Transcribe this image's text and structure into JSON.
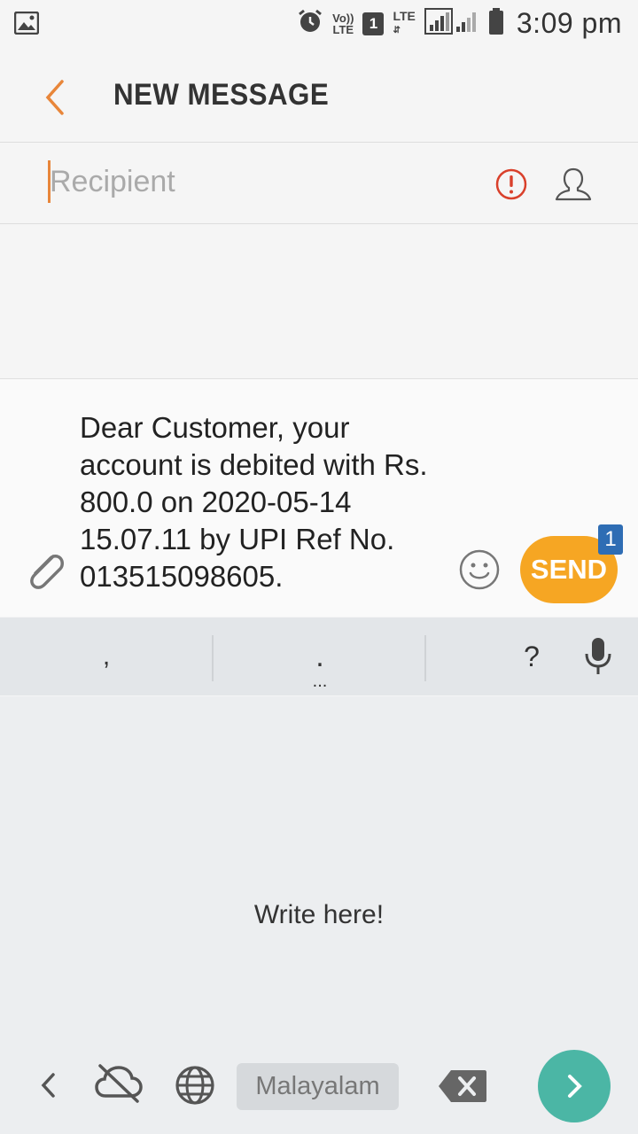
{
  "status_bar": {
    "time": "3:09 pm",
    "volte_line1": "Vo))",
    "volte_line2": "LTE",
    "sim_slot": "1",
    "network": "LTE",
    "icons": [
      "image-icon",
      "alarm-icon",
      "signal-icon",
      "battery-icon"
    ]
  },
  "app_bar": {
    "title": "NEW MESSAGE",
    "accent_color": "#e8863a"
  },
  "recipient": {
    "placeholder": "Recipient",
    "value": ""
  },
  "composer": {
    "message": "Dear Customer, your account is debited with Rs. 800.0 on 2020-05-14 15.07.11 by UPI Ref No. 013515098605.",
    "send_label": "SEND",
    "send_badge": "1",
    "send_color": "#f6a623"
  },
  "keyboard": {
    "key_comma": ",",
    "key_period": ".",
    "key_more": "...",
    "key_question": "?",
    "handwriting_hint": "Write here!",
    "language": "Malayalam",
    "go_color": "#4bb6a5"
  }
}
